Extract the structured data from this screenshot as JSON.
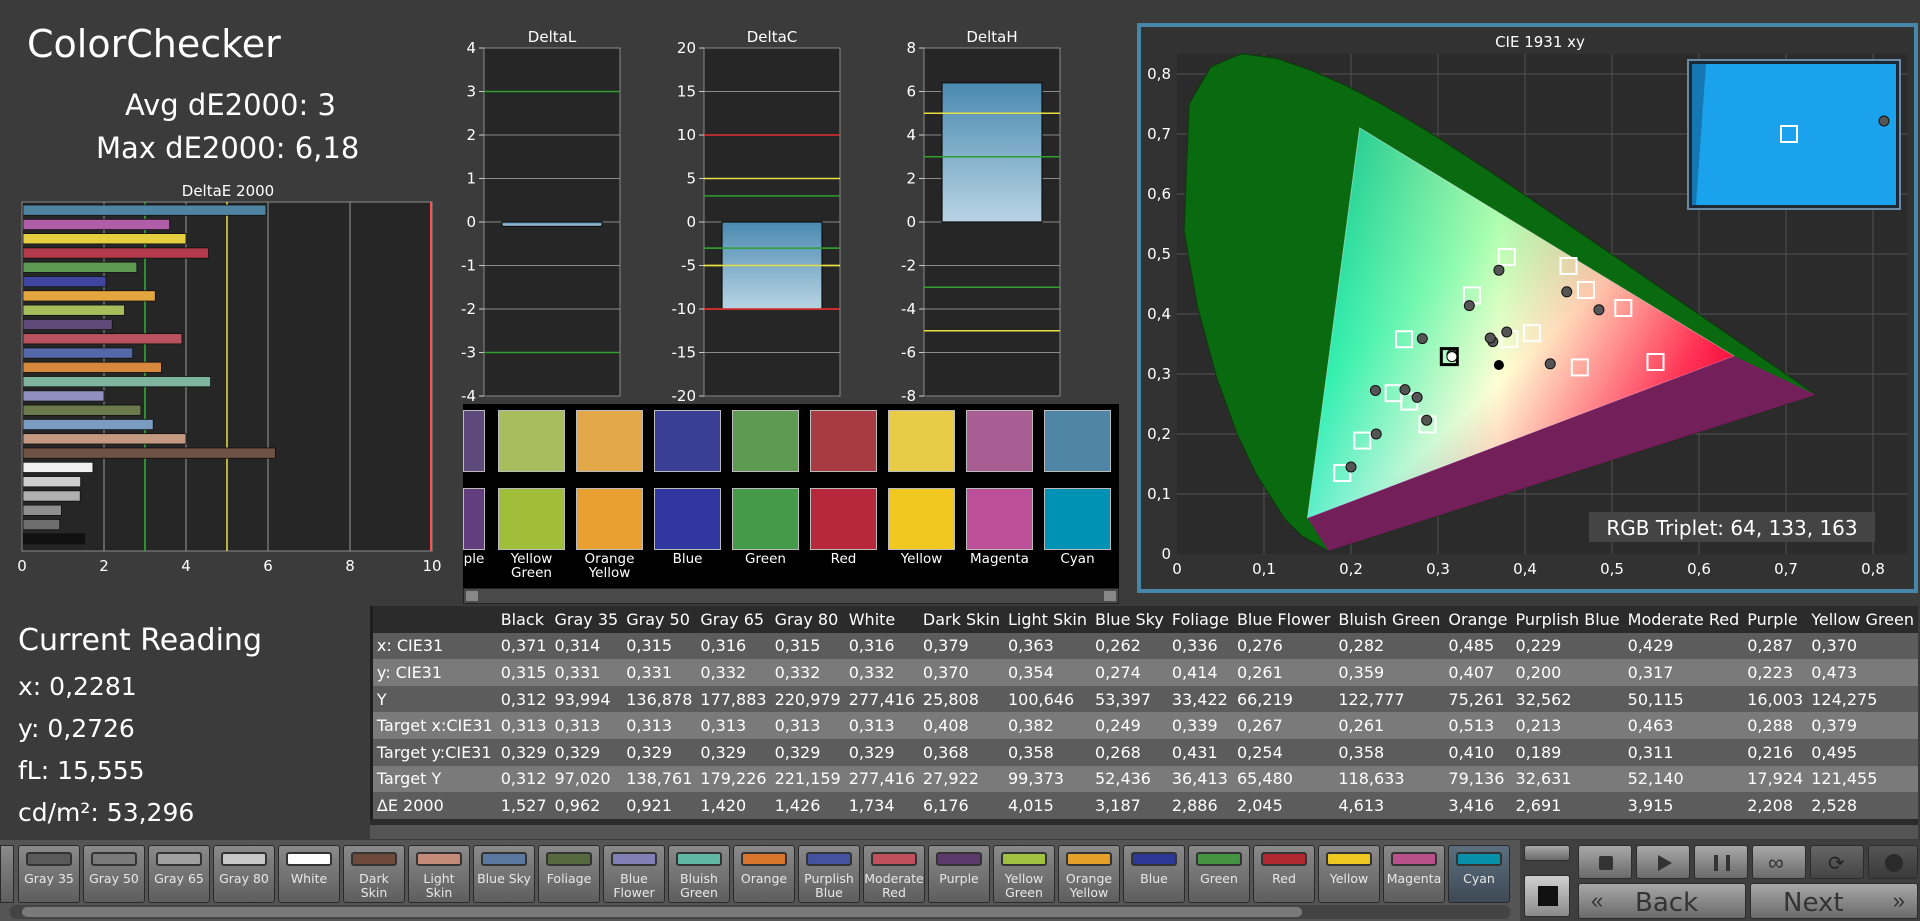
{
  "title": "ColorChecker",
  "avg": "Avg dE2000: 3",
  "max": "Max dE2000: 6,18",
  "deltae": {
    "title": "DeltaE 2000",
    "ticks": [
      "0",
      "2",
      "4",
      "6",
      "8",
      "10"
    ],
    "values": [
      5.95,
      3.6,
      4.0,
      4.55,
      2.8,
      2.05,
      3.25,
      2.5,
      2.2,
      3.9,
      2.7,
      3.4,
      4.6,
      2.0,
      2.9,
      3.2,
      4.0,
      6.18,
      1.73,
      1.43,
      1.42,
      0.96,
      0.92,
      1.53
    ],
    "colors": [
      "#4f84a3",
      "#b15ea9",
      "#e5ce3f",
      "#b33a4a",
      "#5f9a52",
      "#4046a0",
      "#e3a53d",
      "#a5bd5a",
      "#604a7a",
      "#b8525e",
      "#5468a8",
      "#d6883c",
      "#7fb4a0",
      "#9090c0",
      "#6a7a4c",
      "#7a9cc0",
      "#c49982",
      "#6e5244",
      "#f0f0f0",
      "#cfcfcf",
      "#b0b0b0",
      "#8e8e8e",
      "#6e6e6e",
      "#111111"
    ],
    "ref_green": 3,
    "ref_yellow": 5
  },
  "deltal": {
    "title": "DeltaL",
    "ticks": [
      "4",
      "3",
      "2",
      "1",
      "0",
      "-1",
      "-2",
      "-3",
      "-4"
    ],
    "value": -0.1
  },
  "deltac": {
    "title": "DeltaC",
    "ticks": [
      "20",
      "15",
      "10",
      "5",
      "0",
      "-5",
      "-10",
      "-15",
      "-20"
    ],
    "value": -10
  },
  "deltah": {
    "title": "DeltaH",
    "ticks": [
      "8",
      "6",
      "4",
      "2",
      "0",
      "-2",
      "-4",
      "-6",
      "-8"
    ],
    "value": 6.4
  },
  "patches": {
    "actual": [
      "#5e4a7a",
      "#a8bd5e",
      "#e2a84a",
      "#3a3e94",
      "#5e9a52",
      "#a83a42",
      "#e8cc48",
      "#a85e92",
      "#4f86a6"
    ],
    "target": [
      "#623e7e",
      "#a0be3a",
      "#e8a030",
      "#3038a0",
      "#449a48",
      "#b8283c",
      "#f0c820",
      "#bc5098",
      "#0092b4"
    ],
    "labels": [
      "ple",
      "Yellow Green",
      "Orange Yellow",
      "Blue",
      "Green",
      "Red",
      "Yellow",
      "Magenta",
      "Cyan"
    ]
  },
  "cie": {
    "title": "CIE 1931 xy",
    "ticks_x": [
      "0",
      "0,1",
      "0,2",
      "0,3",
      "0,4",
      "0,5",
      "0,6",
      "0,7",
      "0,8"
    ],
    "ticks_y": [
      "0,8",
      "0,7",
      "0,6",
      "0,5",
      "0,4",
      "0,3",
      "0,2",
      "0,1",
      "0"
    ],
    "rgb_triplet": "RGB Triplet: 64, 133, 163",
    "measured": [
      [
        0.336,
        0.414
      ],
      [
        0.276,
        0.261
      ],
      [
        0.282,
        0.359
      ],
      [
        0.485,
        0.407
      ],
      [
        0.229,
        0.2
      ],
      [
        0.429,
        0.317
      ],
      [
        0.287,
        0.223
      ],
      [
        0.37,
        0.473
      ],
      [
        0.2281,
        0.2726
      ],
      [
        0.316,
        0.332
      ],
      [
        0.379,
        0.37
      ],
      [
        0.363,
        0.354
      ],
      [
        0.262,
        0.274
      ],
      [
        0.2,
        0.145
      ],
      [
        0.448,
        0.437
      ],
      [
        0.36,
        0.36
      ]
    ],
    "targets": [
      [
        0.339,
        0.431
      ],
      [
        0.267,
        0.254
      ],
      [
        0.261,
        0.358
      ],
      [
        0.513,
        0.41
      ],
      [
        0.213,
        0.189
      ],
      [
        0.463,
        0.311
      ],
      [
        0.288,
        0.216
      ],
      [
        0.379,
        0.495
      ],
      [
        0.249,
        0.268
      ],
      [
        0.313,
        0.329
      ],
      [
        0.408,
        0.368
      ],
      [
        0.382,
        0.358
      ],
      [
        0.19,
        0.135
      ],
      [
        0.47,
        0.44
      ],
      [
        0.55,
        0.32
      ],
      [
        0.45,
        0.48
      ]
    ]
  },
  "current": {
    "title": "Current Reading",
    "x": "x: 0,2281",
    "y": "y: 0,2726",
    "fl": "fL: 15,555",
    "cd": "cd/m²: 53,296"
  },
  "table": {
    "headers": [
      "Black",
      "Gray 35",
      "Gray 50",
      "Gray 65",
      "Gray 80",
      "White",
      "Dark Skin",
      "Light Skin",
      "Blue Sky",
      "Foliage",
      "Blue Flower",
      "Bluish Green",
      "Orange",
      "Purplish Blue",
      "Moderate Red",
      "Purple",
      "Yellow Green"
    ],
    "rows": [
      [
        "x: CIE31",
        "0,371",
        "0,314",
        "0,315",
        "0,316",
        "0,315",
        "0,316",
        "0,379",
        "0,363",
        "0,262",
        "0,336",
        "0,276",
        "0,282",
        "0,485",
        "0,229",
        "0,429",
        "0,287",
        "0,370"
      ],
      [
        "y: CIE31",
        "0,315",
        "0,331",
        "0,331",
        "0,332",
        "0,332",
        "0,332",
        "0,370",
        "0,354",
        "0,274",
        "0,414",
        "0,261",
        "0,359",
        "0,407",
        "0,200",
        "0,317",
        "0,223",
        "0,473"
      ],
      [
        "Y",
        "0,312",
        "93,994",
        "136,878",
        "177,883",
        "220,979",
        "277,416",
        "25,808",
        "100,646",
        "53,397",
        "33,422",
        "66,219",
        "122,777",
        "75,261",
        "32,562",
        "50,115",
        "16,003",
        "124,275"
      ],
      [
        "Target x:CIE31",
        "0,313",
        "0,313",
        "0,313",
        "0,313",
        "0,313",
        "0,313",
        "0,408",
        "0,382",
        "0,249",
        "0,339",
        "0,267",
        "0,261",
        "0,513",
        "0,213",
        "0,463",
        "0,288",
        "0,379"
      ],
      [
        "Target y:CIE31",
        "0,329",
        "0,329",
        "0,329",
        "0,329",
        "0,329",
        "0,329",
        "0,368",
        "0,358",
        "0,268",
        "0,431",
        "0,254",
        "0,358",
        "0,410",
        "0,189",
        "0,311",
        "0,216",
        "0,495"
      ],
      [
        "Target Y",
        "0,312",
        "97,020",
        "138,761",
        "179,226",
        "221,159",
        "277,416",
        "27,922",
        "99,373",
        "52,436",
        "36,413",
        "65,480",
        "118,633",
        "79,136",
        "32,631",
        "52,140",
        "17,924",
        "121,455"
      ],
      [
        "ΔE 2000",
        "1,527",
        "0,962",
        "0,921",
        "1,420",
        "1,426",
        "1,734",
        "6,176",
        "4,015",
        "3,187",
        "2,886",
        "2,045",
        "4,613",
        "3,416",
        "2,691",
        "3,915",
        "2,208",
        "2,528"
      ]
    ]
  },
  "swatches": [
    {
      "label": "Gray 35",
      "color": "#5a5a5a"
    },
    {
      "label": "Gray 50",
      "color": "#7a7a7a"
    },
    {
      "label": "Gray 65",
      "color": "#a0a0a0"
    },
    {
      "label": "Gray 80",
      "color": "#c8c8c8"
    },
    {
      "label": "White",
      "color": "#ffffff"
    },
    {
      "label": "Dark Skin",
      "color": "#6e4a3c"
    },
    {
      "label": "Light Skin",
      "color": "#c48c78"
    },
    {
      "label": "Blue Sky",
      "color": "#5a78a0"
    },
    {
      "label": "Foliage",
      "color": "#566a40"
    },
    {
      "label": "Blue Flower",
      "color": "#8080b4"
    },
    {
      "label": "Bluish Green",
      "color": "#60b8a4"
    },
    {
      "label": "Orange",
      "color": "#d8742c"
    },
    {
      "label": "Purplish Blue",
      "color": "#4452a0"
    },
    {
      "label": "Moderate Red",
      "color": "#c0505c"
    },
    {
      "label": "Purple",
      "color": "#5c3a6c"
    },
    {
      "label": "Yellow Green",
      "color": "#a0c040"
    },
    {
      "label": "Orange Yellow",
      "color": "#e4a028"
    },
    {
      "label": "Blue",
      "color": "#2c3894"
    },
    {
      "label": "Green",
      "color": "#449444"
    },
    {
      "label": "Red",
      "color": "#b02830"
    },
    {
      "label": "Yellow",
      "color": "#ecc820"
    },
    {
      "label": "Magenta",
      "color": "#b8508c"
    },
    {
      "label": "Cyan",
      "color": "#0890a8"
    }
  ],
  "nav": {
    "back": "Back",
    "next": "Next"
  }
}
